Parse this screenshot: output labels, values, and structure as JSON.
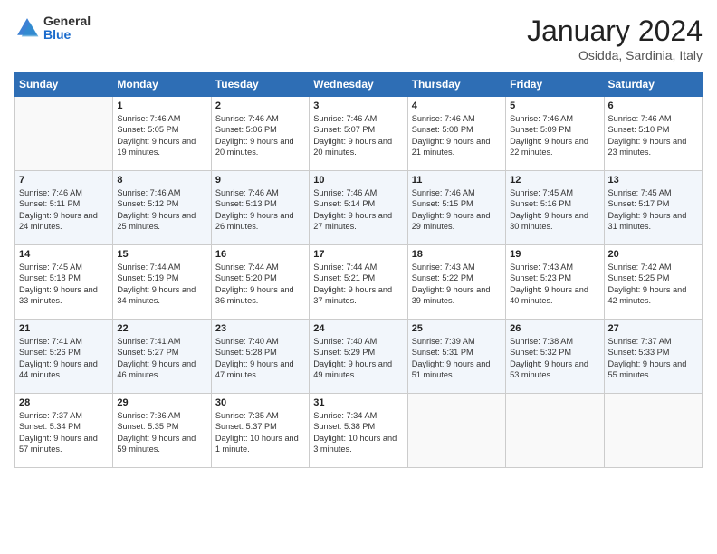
{
  "header": {
    "logo_general": "General",
    "logo_blue": "Blue",
    "month": "January 2024",
    "location": "Osidda, Sardinia, Italy"
  },
  "weekdays": [
    "Sunday",
    "Monday",
    "Tuesday",
    "Wednesday",
    "Thursday",
    "Friday",
    "Saturday"
  ],
  "weeks": [
    [
      {
        "day": "",
        "empty": true
      },
      {
        "day": "1",
        "sunrise": "Sunrise: 7:46 AM",
        "sunset": "Sunset: 5:05 PM",
        "daylight": "Daylight: 9 hours and 19 minutes."
      },
      {
        "day": "2",
        "sunrise": "Sunrise: 7:46 AM",
        "sunset": "Sunset: 5:06 PM",
        "daylight": "Daylight: 9 hours and 20 minutes."
      },
      {
        "day": "3",
        "sunrise": "Sunrise: 7:46 AM",
        "sunset": "Sunset: 5:07 PM",
        "daylight": "Daylight: 9 hours and 20 minutes."
      },
      {
        "day": "4",
        "sunrise": "Sunrise: 7:46 AM",
        "sunset": "Sunset: 5:08 PM",
        "daylight": "Daylight: 9 hours and 21 minutes."
      },
      {
        "day": "5",
        "sunrise": "Sunrise: 7:46 AM",
        "sunset": "Sunset: 5:09 PM",
        "daylight": "Daylight: 9 hours and 22 minutes."
      },
      {
        "day": "6",
        "sunrise": "Sunrise: 7:46 AM",
        "sunset": "Sunset: 5:10 PM",
        "daylight": "Daylight: 9 hours and 23 minutes."
      }
    ],
    [
      {
        "day": "7",
        "sunrise": "Sunrise: 7:46 AM",
        "sunset": "Sunset: 5:11 PM",
        "daylight": "Daylight: 9 hours and 24 minutes."
      },
      {
        "day": "8",
        "sunrise": "Sunrise: 7:46 AM",
        "sunset": "Sunset: 5:12 PM",
        "daylight": "Daylight: 9 hours and 25 minutes."
      },
      {
        "day": "9",
        "sunrise": "Sunrise: 7:46 AM",
        "sunset": "Sunset: 5:13 PM",
        "daylight": "Daylight: 9 hours and 26 minutes."
      },
      {
        "day": "10",
        "sunrise": "Sunrise: 7:46 AM",
        "sunset": "Sunset: 5:14 PM",
        "daylight": "Daylight: 9 hours and 27 minutes."
      },
      {
        "day": "11",
        "sunrise": "Sunrise: 7:46 AM",
        "sunset": "Sunset: 5:15 PM",
        "daylight": "Daylight: 9 hours and 29 minutes."
      },
      {
        "day": "12",
        "sunrise": "Sunrise: 7:45 AM",
        "sunset": "Sunset: 5:16 PM",
        "daylight": "Daylight: 9 hours and 30 minutes."
      },
      {
        "day": "13",
        "sunrise": "Sunrise: 7:45 AM",
        "sunset": "Sunset: 5:17 PM",
        "daylight": "Daylight: 9 hours and 31 minutes."
      }
    ],
    [
      {
        "day": "14",
        "sunrise": "Sunrise: 7:45 AM",
        "sunset": "Sunset: 5:18 PM",
        "daylight": "Daylight: 9 hours and 33 minutes."
      },
      {
        "day": "15",
        "sunrise": "Sunrise: 7:44 AM",
        "sunset": "Sunset: 5:19 PM",
        "daylight": "Daylight: 9 hours and 34 minutes."
      },
      {
        "day": "16",
        "sunrise": "Sunrise: 7:44 AM",
        "sunset": "Sunset: 5:20 PM",
        "daylight": "Daylight: 9 hours and 36 minutes."
      },
      {
        "day": "17",
        "sunrise": "Sunrise: 7:44 AM",
        "sunset": "Sunset: 5:21 PM",
        "daylight": "Daylight: 9 hours and 37 minutes."
      },
      {
        "day": "18",
        "sunrise": "Sunrise: 7:43 AM",
        "sunset": "Sunset: 5:22 PM",
        "daylight": "Daylight: 9 hours and 39 minutes."
      },
      {
        "day": "19",
        "sunrise": "Sunrise: 7:43 AM",
        "sunset": "Sunset: 5:23 PM",
        "daylight": "Daylight: 9 hours and 40 minutes."
      },
      {
        "day": "20",
        "sunrise": "Sunrise: 7:42 AM",
        "sunset": "Sunset: 5:25 PM",
        "daylight": "Daylight: 9 hours and 42 minutes."
      }
    ],
    [
      {
        "day": "21",
        "sunrise": "Sunrise: 7:41 AM",
        "sunset": "Sunset: 5:26 PM",
        "daylight": "Daylight: 9 hours and 44 minutes."
      },
      {
        "day": "22",
        "sunrise": "Sunrise: 7:41 AM",
        "sunset": "Sunset: 5:27 PM",
        "daylight": "Daylight: 9 hours and 46 minutes."
      },
      {
        "day": "23",
        "sunrise": "Sunrise: 7:40 AM",
        "sunset": "Sunset: 5:28 PM",
        "daylight": "Daylight: 9 hours and 47 minutes."
      },
      {
        "day": "24",
        "sunrise": "Sunrise: 7:40 AM",
        "sunset": "Sunset: 5:29 PM",
        "daylight": "Daylight: 9 hours and 49 minutes."
      },
      {
        "day": "25",
        "sunrise": "Sunrise: 7:39 AM",
        "sunset": "Sunset: 5:31 PM",
        "daylight": "Daylight: 9 hours and 51 minutes."
      },
      {
        "day": "26",
        "sunrise": "Sunrise: 7:38 AM",
        "sunset": "Sunset: 5:32 PM",
        "daylight": "Daylight: 9 hours and 53 minutes."
      },
      {
        "day": "27",
        "sunrise": "Sunrise: 7:37 AM",
        "sunset": "Sunset: 5:33 PM",
        "daylight": "Daylight: 9 hours and 55 minutes."
      }
    ],
    [
      {
        "day": "28",
        "sunrise": "Sunrise: 7:37 AM",
        "sunset": "Sunset: 5:34 PM",
        "daylight": "Daylight: 9 hours and 57 minutes."
      },
      {
        "day": "29",
        "sunrise": "Sunrise: 7:36 AM",
        "sunset": "Sunset: 5:35 PM",
        "daylight": "Daylight: 9 hours and 59 minutes."
      },
      {
        "day": "30",
        "sunrise": "Sunrise: 7:35 AM",
        "sunset": "Sunset: 5:37 PM",
        "daylight": "Daylight: 10 hours and 1 minute."
      },
      {
        "day": "31",
        "sunrise": "Sunrise: 7:34 AM",
        "sunset": "Sunset: 5:38 PM",
        "daylight": "Daylight: 10 hours and 3 minutes."
      },
      {
        "day": "",
        "empty": true
      },
      {
        "day": "",
        "empty": true
      },
      {
        "day": "",
        "empty": true
      }
    ]
  ]
}
